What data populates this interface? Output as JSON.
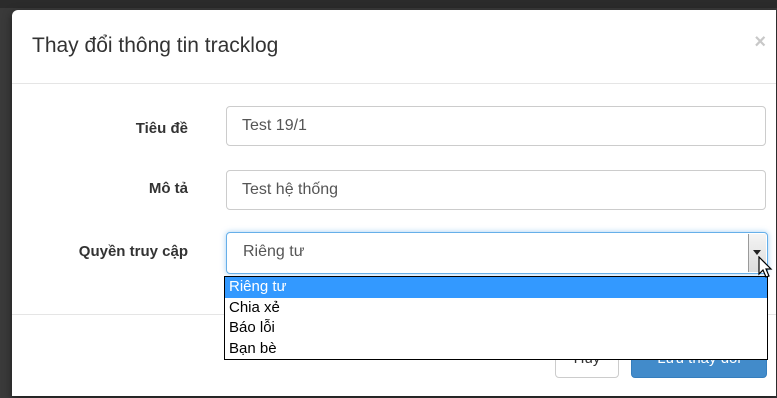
{
  "modal": {
    "title": "Thay đổi thông tin tracklog",
    "close": "×"
  },
  "form": {
    "title_label": "Tiêu đề",
    "title_value": "Test 19/1",
    "description_label": "Mô tả",
    "description_value": "Test hệ thống",
    "access_label": "Quyền truy cập",
    "access_value": "Riêng tư",
    "access_options": [
      "Riêng tư",
      "Chia xẻ",
      "Báo lỗi",
      "Bạn bè"
    ]
  },
  "footer": {
    "cancel_label": "Hủy",
    "save_label": "Lưu thay đổi"
  },
  "colors": {
    "primary": "#428bca",
    "selected_option": "#3399ff",
    "focus_border": "#66afe9"
  }
}
